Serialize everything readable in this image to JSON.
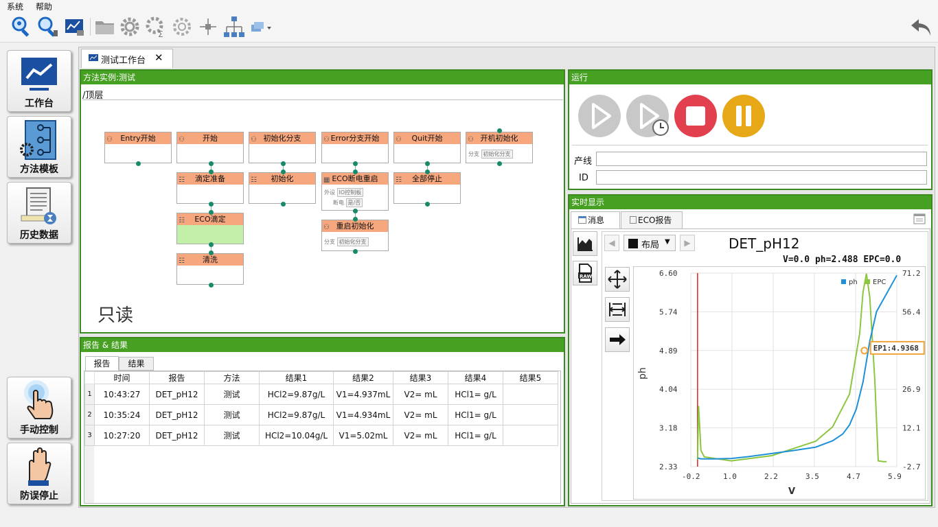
{
  "menu": {
    "system": "系统",
    "help": "帮助"
  },
  "toolbar_icons": [
    "search-user-icon",
    "search-zoom-icon",
    "chart-window-icon",
    "folder-icon",
    "gear-icon",
    "gear-sum-icon",
    "gear-outline-icon",
    "node-icon",
    "hierarchy-icon",
    "layers-dropdown-icon",
    "back-arrow-icon"
  ],
  "nav": {
    "workbench": "工作台",
    "method_template": "方法模板",
    "history": "历史数据",
    "manual": "手动控制",
    "emergency": "防误停止"
  },
  "doc_tab": {
    "label": "测试工作台",
    "close": "✕"
  },
  "method": {
    "header": "方法实例:测试",
    "path": "/顶层",
    "readonly": "只读",
    "nodes": {
      "entry": "Entry开始",
      "start": "开始",
      "init_branch": "初始化分支",
      "error": "Error分支开始",
      "quit": "Quit开始",
      "boot": "开机初始化",
      "titrate_prep": "滴定准备",
      "init": "初始化",
      "eco_restart": "ECO断电重启",
      "stop_all": "全部停止",
      "eco_titrate": "ECO滴定",
      "clean": "清洗",
      "restart_init": "重启初始化"
    },
    "mini": {
      "boot_label": "分支",
      "boot_val": "初始化分支",
      "eco_label": "外设",
      "eco_val": "IO控制板",
      "eco_label2": "断电",
      "eco_opt": "是/否",
      "restart_label": "分支",
      "restart_val": "初始化分支"
    }
  },
  "report": {
    "header": "报告 & 结果",
    "tabs": [
      "报告",
      "结果"
    ],
    "columns": [
      "时间",
      "报告",
      "方法",
      "结果1",
      "结果2",
      "结果3",
      "结果4",
      "结果5"
    ],
    "rows": [
      {
        "idx": "1",
        "time": "10:43:27",
        "report": "DET_pH12",
        "method": "测试",
        "r1": "HCl2=9.87g/L",
        "r2": "V1=4.937mL",
        "r3": "V2= mL",
        "r4": "HCl1= g/L",
        "r5": ""
      },
      {
        "idx": "2",
        "time": "10:35:24",
        "report": "DET_pH12",
        "method": "测试",
        "r1": "HCl2=9.87g/L",
        "r2": "V1=4.934mL",
        "r3": "V2= mL",
        "r4": "HCl1= g/L",
        "r5": ""
      },
      {
        "idx": "3",
        "time": "10:27:20",
        "report": "DET_pH12",
        "method": "测试",
        "r1": "HCl2=10.04g/L",
        "r2": "V1=5.02mL",
        "r3": "V2= mL",
        "r4": "HCl1= g/L",
        "r5": ""
      }
    ]
  },
  "run": {
    "header": "运行",
    "line_label": "产线",
    "id_label": "ID",
    "line_value": "",
    "id_value": "",
    "colors": {
      "play": "#c8c8c8",
      "stop": "#e2404e",
      "pause": "#e6a817"
    }
  },
  "realtime": {
    "header": "实时显示",
    "tabs": [
      "消息",
      "ECO报告"
    ],
    "layout_label": "布局",
    "chart_title": "DET_pH12",
    "readout": "V=0.0 ph=2.488 EPC=0.0",
    "marker_label": "EP1:4.9368"
  },
  "chart_data": {
    "type": "line",
    "title": "DET_pH12",
    "xlabel": "V",
    "ylabel": "ph",
    "xlim": [
      -0.2,
      5.9
    ],
    "ylim": [
      2.33,
      6.6
    ],
    "y2lim": [
      -2.7,
      71.2
    ],
    "x_ticks": [
      "-0.2",
      "1.0",
      "2.2",
      "3.5",
      "4.7",
      "5.9"
    ],
    "y_ticks": [
      "2.33",
      "3.18",
      "4.04",
      "4.89",
      "5.74",
      "6.60"
    ],
    "y2_ticks": [
      "-2.7",
      "12.1",
      "26.9",
      "41.6",
      "56.4",
      "71.2"
    ],
    "legend": [
      "ph",
      "EPC"
    ],
    "legend_position": "top-right",
    "series": [
      {
        "name": "ph",
        "axis": "left",
        "color": "#1e90d8",
        "x": [
          0.0,
          0.1,
          0.5,
          1.0,
          1.5,
          2.2,
          2.8,
          3.5,
          4.0,
          4.3,
          4.5,
          4.7,
          4.9,
          5.1,
          5.3,
          5.6,
          5.9
        ],
        "y": [
          2.52,
          2.5,
          2.5,
          2.51,
          2.55,
          2.62,
          2.68,
          2.76,
          2.9,
          3.05,
          3.25,
          3.6,
          4.2,
          5.1,
          5.75,
          6.15,
          6.55
        ]
      },
      {
        "name": "EPC",
        "axis": "right",
        "color": "#8cc63f",
        "x": [
          0.0,
          0.03,
          0.1,
          0.2,
          1.0,
          2.2,
          3.5,
          4.0,
          4.5,
          4.8,
          4.9,
          5.0,
          5.1,
          5.25,
          5.35,
          5.5,
          5.6
        ],
        "y": [
          0.0,
          20.5,
          3.5,
          1.0,
          -0.5,
          1.5,
          7.0,
          12.5,
          25.0,
          48.0,
          64.0,
          71.0,
          62.0,
          30.0,
          -0.5,
          -0.8,
          -0.8
        ]
      }
    ],
    "annotations": [
      {
        "text": "EP1:4.9368",
        "x": 4.94,
        "y": 4.89
      }
    ],
    "vertical_marker_x": 0.0,
    "grid": true
  }
}
